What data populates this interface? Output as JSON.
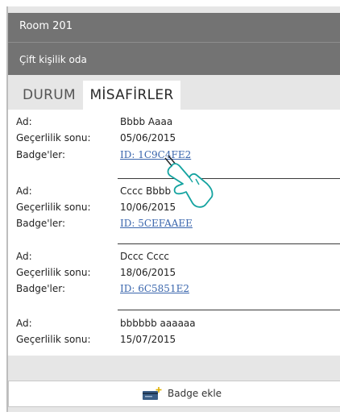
{
  "header": {
    "room_title": "Room 201",
    "room_type": "Çift kişilik oda"
  },
  "tabs": [
    {
      "label": "DURUM",
      "active": false
    },
    {
      "label": "MİSAFİRLER",
      "active": true
    }
  ],
  "labels": {
    "name": "Ad:",
    "expiry": "Geçerlilik sonu:",
    "badges": "Badge'ler:"
  },
  "guests": [
    {
      "name": "Bbbb Aaaa",
      "expiry": "05/06/2015",
      "badge": "ID: 1C9C4FE2"
    },
    {
      "name": "Cccc Bbbb",
      "expiry": "10/06/2015",
      "badge": "ID: 5CEFAAEE"
    },
    {
      "name": "Dccc Cccc",
      "expiry": "18/06/2015",
      "badge": "ID: 6C5851E2"
    },
    {
      "name": "bbbbbb aaaaaa",
      "expiry": "15/07/2015"
    }
  ],
  "footer": {
    "add_badge_label": "Badge ekle",
    "icon": "card-add-icon"
  },
  "colors": {
    "header_bg": "#737373",
    "link": "#3a66ad",
    "page_bg": "#e6e6e6"
  }
}
